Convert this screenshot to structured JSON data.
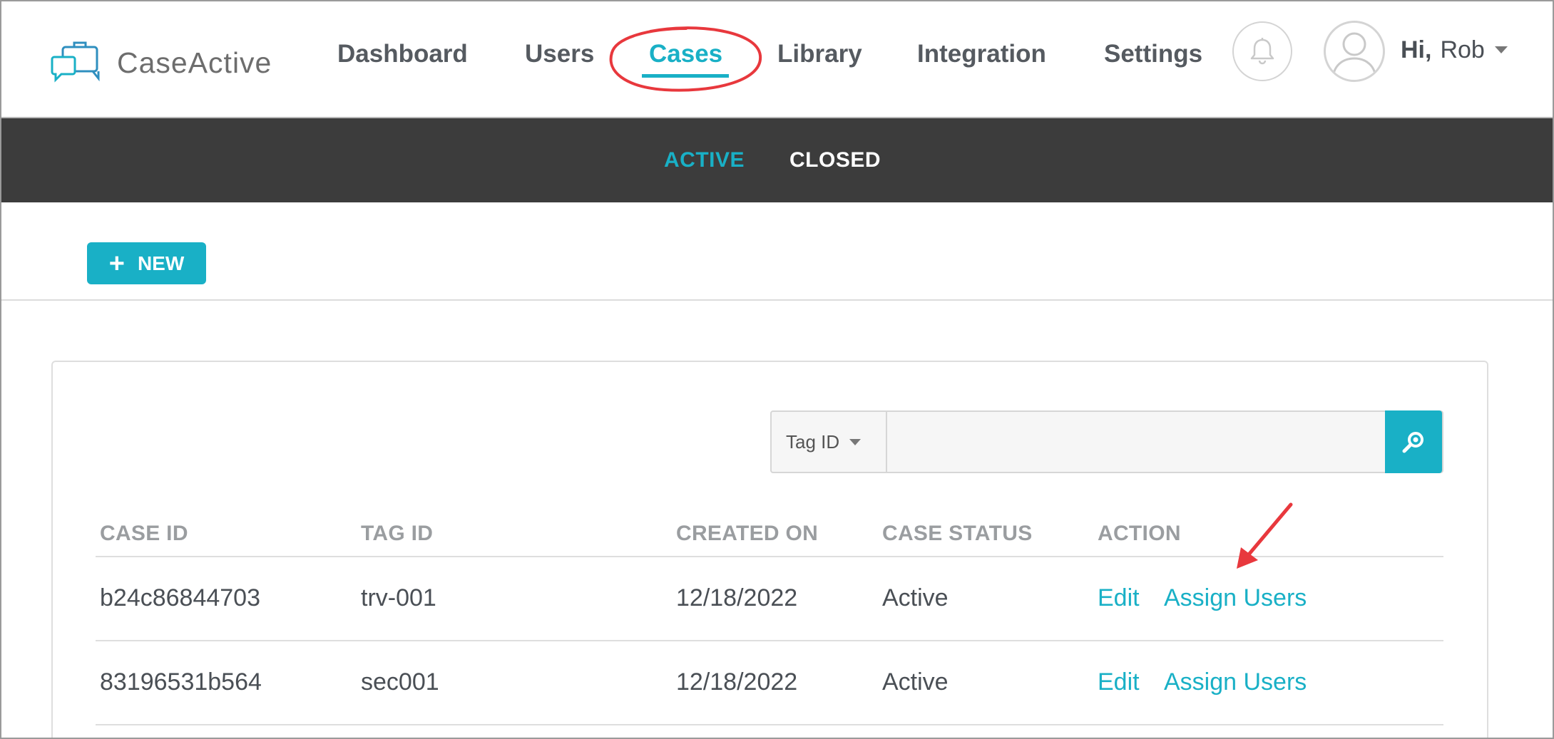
{
  "logo": {
    "text": "CaseActive"
  },
  "nav": {
    "links": [
      {
        "label": "Dashboard"
      },
      {
        "label": "Users"
      },
      {
        "label": "Cases"
      },
      {
        "label": "Library"
      },
      {
        "label": "Integration"
      },
      {
        "label": "Settings"
      }
    ],
    "active": "Cases"
  },
  "user": {
    "greeting": "Hi,",
    "name": "Rob"
  },
  "subnav": {
    "tabs": [
      {
        "label": "ACTIVE"
      },
      {
        "label": "CLOSED"
      }
    ],
    "active": "ACTIVE"
  },
  "toolbar": {
    "new_label": "NEW"
  },
  "search": {
    "filter_label": "Tag ID",
    "value": "",
    "placeholder": ""
  },
  "table": {
    "columns": [
      "CASE ID",
      "TAG ID",
      "CREATED ON",
      "CASE STATUS",
      "ACTION"
    ],
    "rows": [
      {
        "case_id": "b24c86844703",
        "tag_id": "trv-001",
        "created_on": "12/18/2022",
        "status": "Active",
        "edit": "Edit",
        "assign": "Assign Users"
      },
      {
        "case_id": "83196531b564",
        "tag_id": "sec001",
        "created_on": "12/18/2022",
        "status": "Active",
        "edit": "Edit",
        "assign": "Assign Users"
      }
    ]
  },
  "colors": {
    "accent": "#19b0c6",
    "subnav_bg": "#3c3c3c",
    "annotation": "#e8383d"
  }
}
